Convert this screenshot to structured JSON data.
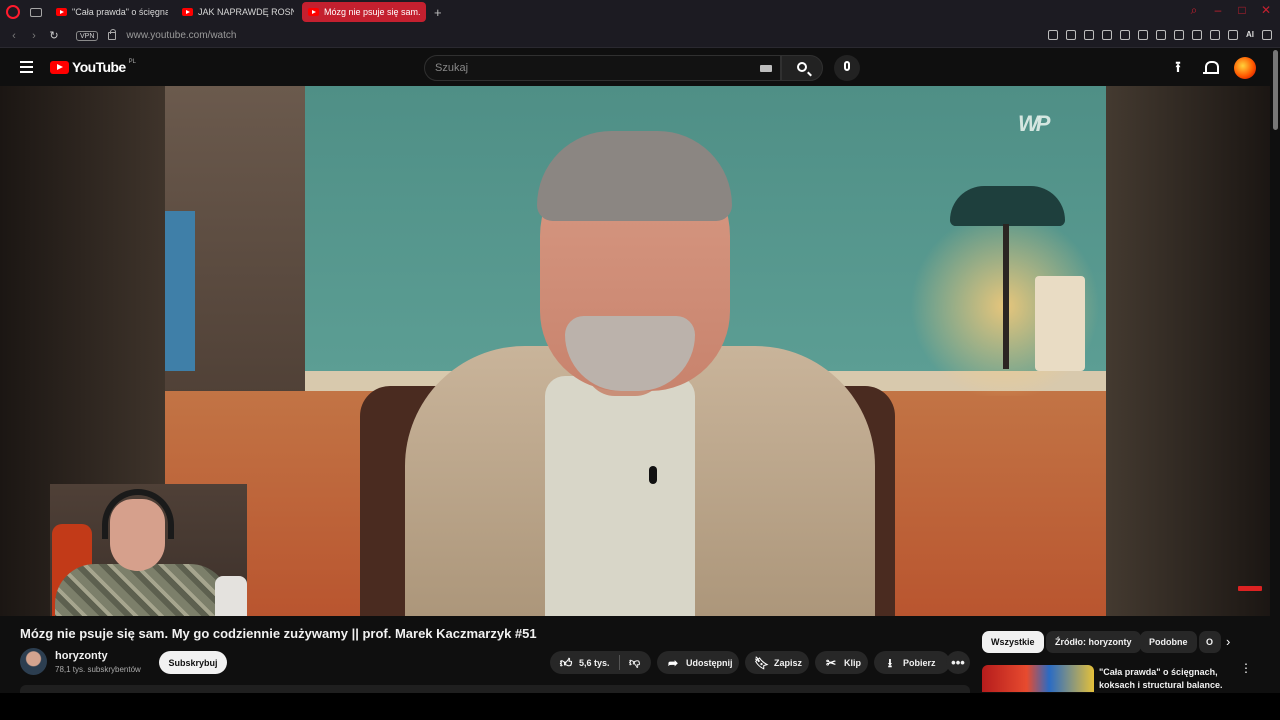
{
  "browser": {
    "tabs": [
      {
        "label": "\"Cała prawda\" o ścięgnach"
      },
      {
        "label": "JAK NAPRAWDĘ ROSNĄ"
      },
      {
        "label": "Mózg nie psuje się sam. M",
        "active": true
      }
    ],
    "new_tab_icon": "plus-icon",
    "vpn_label": "VPN",
    "url": "www.youtube.com/watch",
    "ai_label": "AI"
  },
  "header": {
    "logo_word": "YouTube",
    "region": "PL",
    "search_placeholder": "Szukaj"
  },
  "video": {
    "title": "Mózg nie psuje się sam. My go codziennie zużywamy || prof. Marek Kaczmarzyk #51",
    "watermark": "WP"
  },
  "channel": {
    "name": "horyzonty",
    "subscribers": "78,1 tys. subskrybentów",
    "subscribe_label": "Subskrybuj"
  },
  "actions": {
    "likes": "5,6 tys.",
    "share": "Udostępnij",
    "save": "Zapisz",
    "clip": "Klip",
    "download": "Pobierz"
  },
  "chips": [
    {
      "label": "Wszystkie",
      "active": true
    },
    {
      "label": "Źródło: horyzonty"
    },
    {
      "label": "Podobne"
    },
    {
      "label": "O"
    }
  ],
  "recommendation": {
    "title": "\"Cała prawda\" o ścięgnach, koksach i structural balance."
  }
}
